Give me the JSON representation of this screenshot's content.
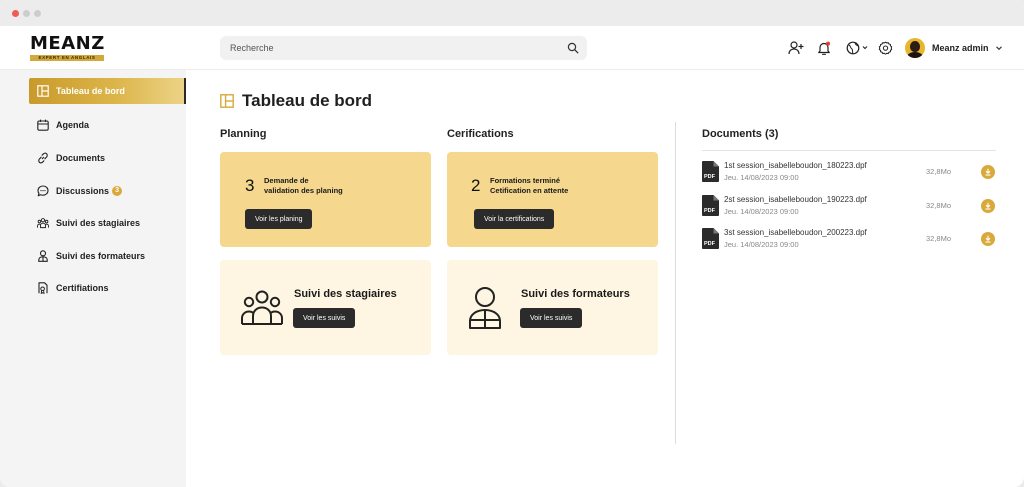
{
  "brand": {
    "name": "MEANZ",
    "tagline": "EXPERT EN ANGLAIS",
    "accent": "#d9a93a"
  },
  "search": {
    "placeholder": "Recherche"
  },
  "header_icons": [
    "add-user-icon",
    "bell-icon",
    "globe-icon",
    "gear-icon"
  ],
  "notification_dot_color": "#e53935",
  "user": {
    "name": "Meanz admin"
  },
  "sidebar": {
    "items": [
      {
        "label": "Tableau de bord",
        "icon": "dashboard-icon",
        "active": true
      },
      {
        "label": "Agenda",
        "icon": "calendar-icon"
      },
      {
        "label": "Documents",
        "icon": "link-icon"
      },
      {
        "label": "Discussions",
        "icon": "chat-icon",
        "badge": "3"
      },
      {
        "label": "Suivi des stagiaires",
        "icon": "group-icon"
      },
      {
        "label": "Suivi des formateurs",
        "icon": "person-icon"
      },
      {
        "label": "Certifiations",
        "icon": "certificate-icon"
      }
    ]
  },
  "page": {
    "title": "Tableau de bord"
  },
  "planning": {
    "title": "Planning",
    "count": "3",
    "line1": "Demande de",
    "line2": "validation des planing",
    "button": "Voir les planing"
  },
  "certifications": {
    "title": "Cerifications",
    "count": "2",
    "line1": "Formations terminé",
    "line2": "Cetification en attente",
    "button": "Voir la certifications"
  },
  "stagiaires": {
    "title": "Suivi des stagiaires",
    "button": "Voir les suivis"
  },
  "formateurs": {
    "title": "Suivi des formateurs",
    "button": "Voir les suivis"
  },
  "documents": {
    "title": "Documents (3)",
    "items": [
      {
        "name": "1st session_isabelleboudon_180223.dpf",
        "date": "Jeu. 14/08/2023 09:00",
        "size": "32,8Mo",
        "type": "PDF"
      },
      {
        "name": "2st session_isabelleboudon_190223.dpf",
        "date": "Jeu. 14/08/2023 09:00",
        "size": "32,8Mo",
        "type": "PDF"
      },
      {
        "name": "3st session_isabelleboudon_200223.dpf",
        "date": "Jeu. 14/08/2023 09:00",
        "size": "32,8Mo",
        "type": "PDF"
      }
    ]
  }
}
